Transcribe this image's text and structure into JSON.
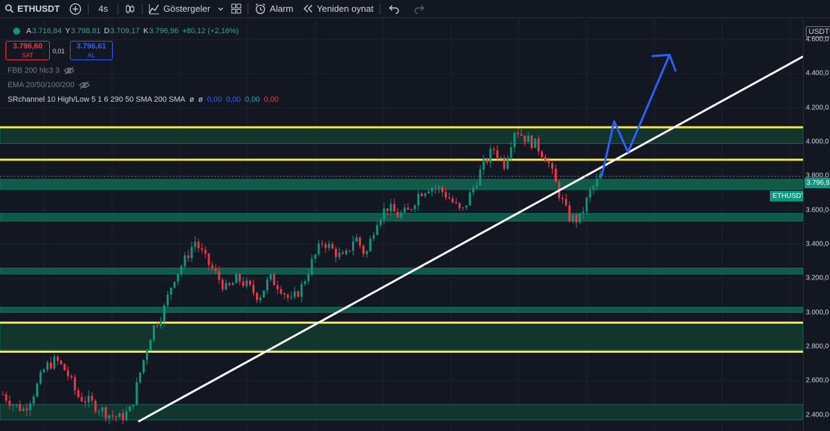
{
  "toolbar": {
    "symbol": "ETHUSDT",
    "interval": "4s",
    "indicators_label": "Göstergeler",
    "alarm_label": "Alarm",
    "replay_label": "Yeniden oynat"
  },
  "legend": {
    "ohlc": {
      "open_key": "A",
      "open": "3.716,84",
      "high_key": "Y",
      "high": "3.798,81",
      "low_key": "D",
      "low": "3.709,17",
      "close_key": "K",
      "close": "3.796,96",
      "change": "+80,12 (+2,16%)"
    },
    "sell": {
      "price": "3.796,60",
      "label": "SAT"
    },
    "spread": "0,01",
    "buy": {
      "price": "3.796,61",
      "label": "AL"
    },
    "indicators": [
      {
        "name": "FBB 200 hlc3 3"
      },
      {
        "name": "EMA 20/50/100/200"
      },
      {
        "name": "SRchannel 10 High/Low 5 1 6 290 50 SMA 200 SMA",
        "values": [
          "ø",
          "ø",
          "0,00",
          "0,00",
          "0,00",
          "0,00"
        ]
      }
    ]
  },
  "price_axis": {
    "currency": "USDT",
    "ticks": [
      "4.600,0",
      "4.400,0",
      "4.200,0",
      "4.000,0",
      "3.800,0",
      "3.600,0",
      "3.400,0",
      "3.200,0",
      "3.000,0",
      "2.800,0",
      "2.600,0",
      "2.400,0"
    ],
    "last_price": "3.796,9",
    "symbol_tag": "ETHUSDT"
  },
  "colors": {
    "bull": "#089981",
    "bear": "#f23645",
    "zone": "#0f5f4a",
    "zone_light": "#12352e",
    "yellow_line": "#ffeb3b",
    "trendline": "#ffffff",
    "projection": "#2962ff"
  },
  "chart_data": {
    "type": "candlestick",
    "symbol": "ETHUSDT",
    "interval": "4s",
    "price_ticks": [
      4600,
      4400,
      4200,
      4000,
      3800,
      3600,
      3400,
      3200,
      3000,
      2800,
      2600,
      2400
    ],
    "ylim": [
      2320,
      4800
    ],
    "last_close": 3796.96,
    "price_path": [
      2520,
      2460,
      2430,
      2540,
      2680,
      2720,
      2650,
      2510,
      2480,
      2440,
      2400,
      2380,
      2430,
      2680,
      2900,
      3000,
      3200,
      3300,
      3420,
      3310,
      3220,
      3130,
      3200,
      3150,
      3090,
      3200,
      3150,
      3060,
      3150,
      3300,
      3420,
      3360,
      3310,
      3450,
      3330,
      3540,
      3620,
      3570,
      3590,
      3700,
      3740,
      3720,
      3660,
      3580,
      3720,
      3860,
      3960,
      3870,
      4080,
      4020,
      3980,
      3900,
      3720,
      3560,
      3540,
      3700,
      3800
    ],
    "support_resistance_zones": [
      [
        3990,
        4085
      ],
      [
        3720,
        3780
      ],
      [
        3535,
        3580
      ],
      [
        3225,
        3260
      ],
      [
        3000,
        3030
      ],
      [
        2780,
        2940
      ],
      [
        2370,
        2460
      ]
    ],
    "horizontal_lines": [
      4085,
      3895,
      2940,
      2770
    ],
    "trendline": {
      "from": [
        0,
        2360
      ],
      "to": [
        1,
        4500
      ]
    },
    "projection_path": [
      3800,
      4120,
      3940,
      4510
    ]
  }
}
